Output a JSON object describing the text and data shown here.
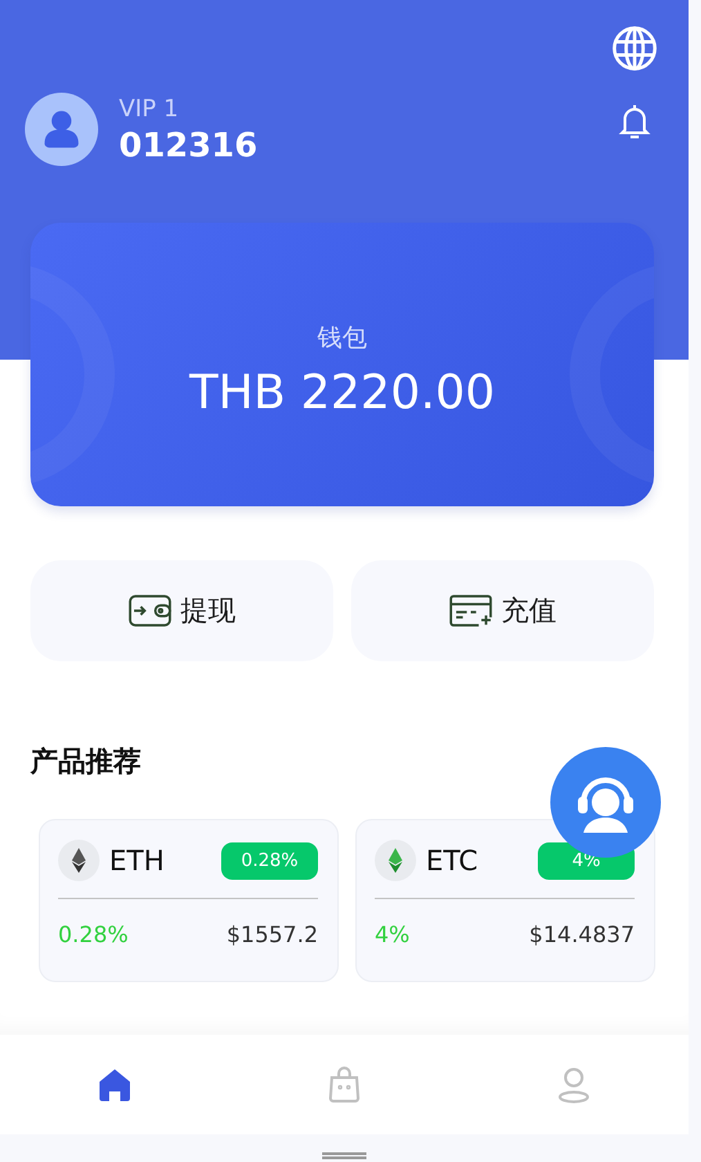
{
  "user": {
    "level": "VIP 1",
    "id": "012316"
  },
  "wallet": {
    "label": "钱包",
    "balance": "THB 2220.00"
  },
  "actions": [
    {
      "kind": "withdraw",
      "label": "提现"
    },
    {
      "kind": "deposit",
      "label": "充值"
    }
  ],
  "section_title": "产品推荐",
  "products": [
    {
      "kind": "eth",
      "symbol": "ETH",
      "badge": "0.28%",
      "change": "0.28%",
      "price": "$1557.2"
    },
    {
      "kind": "etc",
      "symbol": "ETC",
      "badge": "4%",
      "change": "4%",
      "price": "$14.4837"
    }
  ],
  "nav": [
    {
      "kind": "home",
      "selected": true
    },
    {
      "kind": "bag",
      "selected": false
    },
    {
      "kind": "profile",
      "selected": false
    }
  ]
}
